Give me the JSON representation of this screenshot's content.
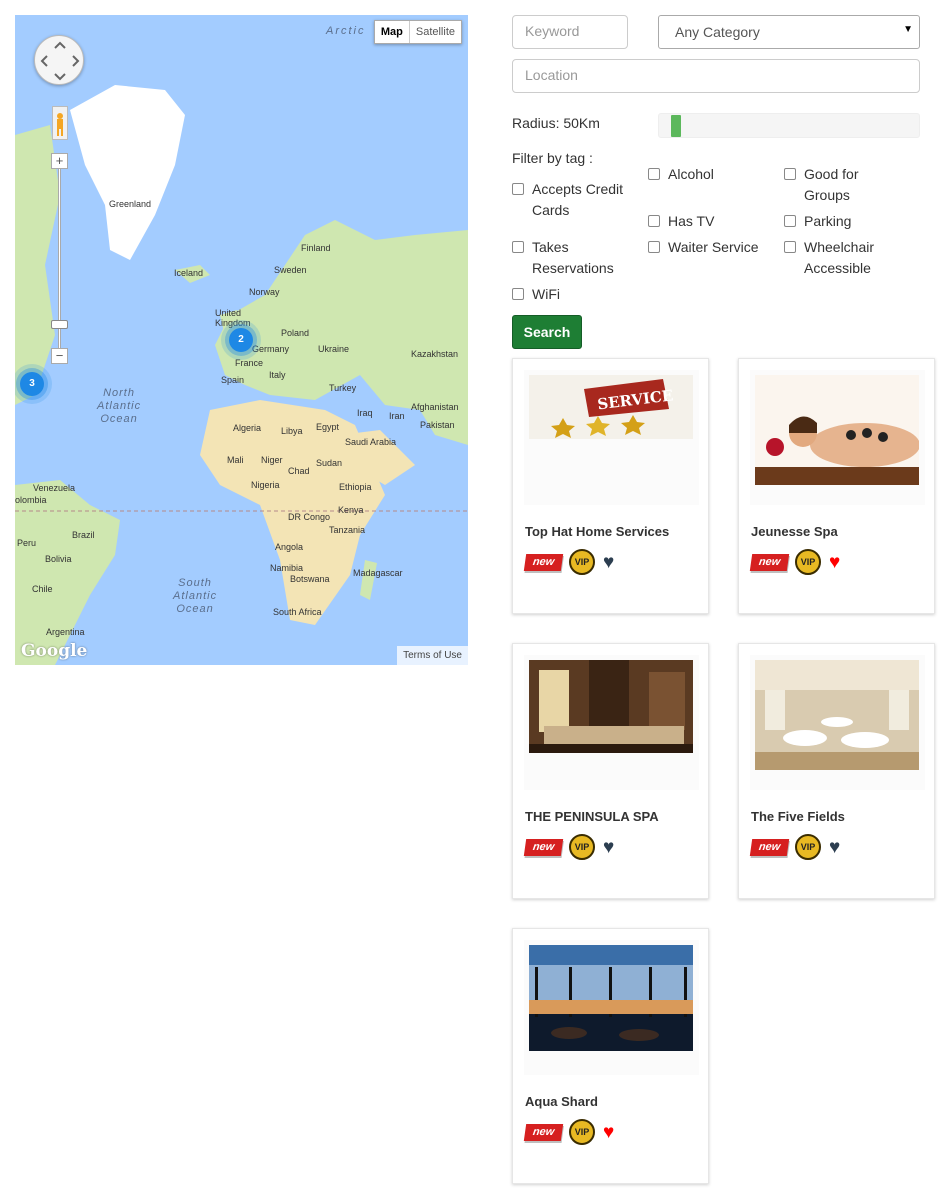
{
  "map": {
    "type_controls": {
      "map": "Map",
      "satellite": "Satellite"
    },
    "clusters": [
      {
        "count": "2"
      },
      {
        "count": "3"
      }
    ],
    "terms": "Terms of Use",
    "google_logo": "Google",
    "labels": {
      "arctic": "Arctic",
      "greenland": "Greenland",
      "iceland": "Iceland",
      "finland": "Finland",
      "sweden": "Sweden",
      "norway": "Norway",
      "united_kingdom": "United\nKingdom",
      "poland": "Poland",
      "germany": "Germany",
      "ukraine": "Ukraine",
      "kazakhstan": "Kazakhstan",
      "france": "France",
      "italy": "Italy",
      "spain": "Spain",
      "turkey": "Turkey",
      "iraq": "Iraq",
      "iran": "Iran",
      "afghanistan": "Afghanistan",
      "pakistan": "Pakistan",
      "algeria": "Algeria",
      "libya": "Libya",
      "egypt": "Egypt",
      "saudi_arabia": "Saudi Arabia",
      "mali": "Mali",
      "niger": "Niger",
      "chad": "Chad",
      "sudan": "Sudan",
      "nigeria": "Nigeria",
      "ethiopia": "Ethiopia",
      "kenya": "Kenya",
      "dr_congo": "DR Congo",
      "tanzania": "Tanzania",
      "angola": "Angola",
      "namibia": "Namibia",
      "botswana": "Botswana",
      "madagascar": "Madagascar",
      "south_africa": "South Africa",
      "venezuela": "Venezuela",
      "colombia": "olombia",
      "peru": "Peru",
      "brazil": "Brazil",
      "bolivia": "Bolivia",
      "chile": "Chile",
      "argentina": "Argentina",
      "north_atlantic": "North\nAtlantic\nOcean",
      "south_atlantic": "South\nAtlantic\nOcean"
    }
  },
  "search": {
    "keyword_placeholder": "Keyword",
    "category_selected": "Any Category",
    "location_placeholder": "Location",
    "radius_label": "Radius: 50Km",
    "radius_value_km": 50,
    "filter_label": "Filter by tag :",
    "tags": [
      {
        "label": "Accepts Credit Cards"
      },
      {
        "label": "Takes Reservations"
      },
      {
        "label": "WiFi"
      },
      {
        "label": "Alcohol"
      },
      {
        "label": "Has TV"
      },
      {
        "label": "Waiter Service"
      },
      {
        "label": "Good for Groups"
      },
      {
        "label": "Parking"
      },
      {
        "label": "Wheelchair Accessible"
      }
    ],
    "button_label": "Search"
  },
  "listings": [
    {
      "title": "Top Hat Home Services",
      "new_badge": "new",
      "vip_badge": "VIP",
      "favorite": false,
      "image_text": "SERVICE"
    },
    {
      "title": "Jeunesse Spa",
      "new_badge": "new",
      "vip_badge": "VIP",
      "favorite": true
    },
    {
      "title": "THE PENINSULA SPA",
      "new_badge": "new",
      "vip_badge": "VIP",
      "favorite": false
    },
    {
      "title": "The Five Fields",
      "new_badge": "new",
      "vip_badge": "VIP",
      "favorite": false
    },
    {
      "title": "Aqua Shard",
      "new_badge": "new",
      "vip_badge": "VIP",
      "favorite": true
    }
  ],
  "colors": {
    "search_button": "#1e7e34",
    "heart_favorite": "#ff0000",
    "heart_default": "#2c3e50",
    "slider_fill": "#5cb85c",
    "cluster": "#1e88e5"
  }
}
